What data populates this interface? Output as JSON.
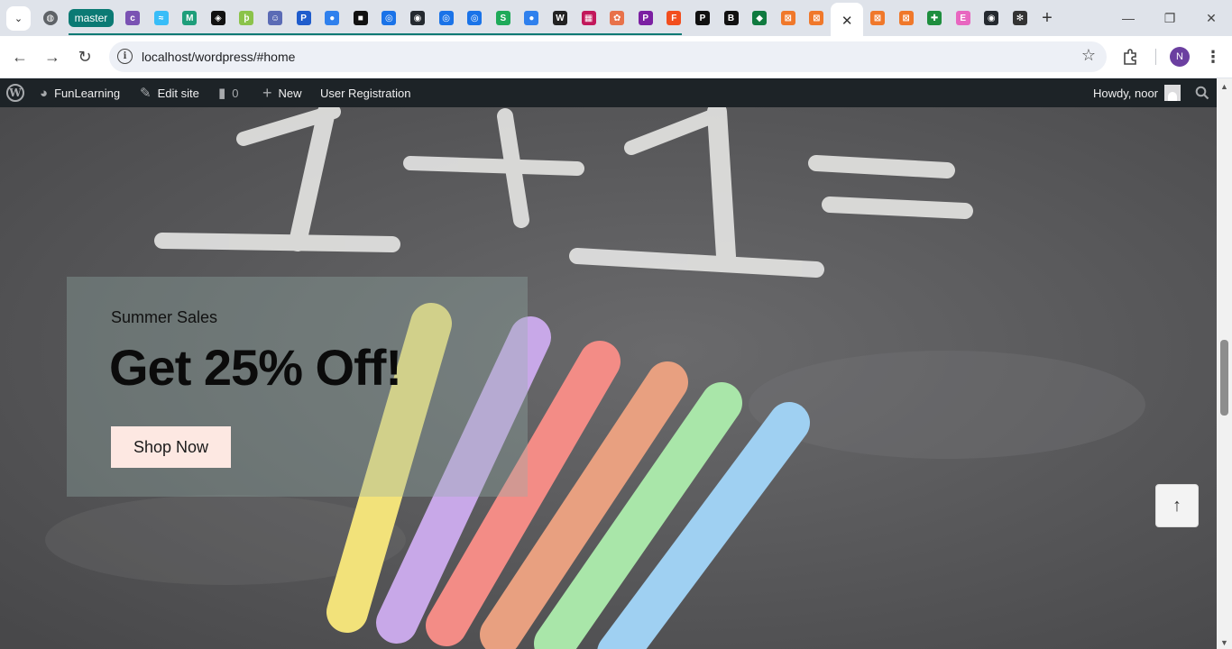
{
  "browser": {
    "tab_group_label": "master",
    "active_tab_close": "✕",
    "new_tab": "+",
    "window": {
      "minimize": "—",
      "restore": "❐",
      "close": "✕"
    },
    "tab_favicons": [
      {
        "name": "globe-favicon",
        "color": "#5f6368",
        "glyph": "◍"
      },
      {
        "name": "colorlib-favicon",
        "color": "#7a52b3",
        "glyph": "c"
      },
      {
        "name": "tailwind-favicon",
        "color": "#38bdf8",
        "glyph": "≈"
      },
      {
        "name": "dictionary-favicon",
        "color": "#1e9e7a",
        "glyph": "M"
      },
      {
        "name": "codepen-favicon",
        "color": "#111111",
        "glyph": "◈"
      },
      {
        "name": "feather-favicon",
        "color": "#8bc34a",
        "glyph": "ϸ"
      },
      {
        "name": "avatar-favicon",
        "color": "#5b6bb5",
        "glyph": "☺"
      },
      {
        "name": "pc-favicon",
        "color": "#1f5ccc",
        "glyph": "P"
      },
      {
        "name": "circle-favicon",
        "color": "#2f80ed",
        "glyph": "●"
      },
      {
        "name": "square-favicon",
        "color": "#111111",
        "glyph": "■"
      },
      {
        "name": "ring-favicon",
        "color": "#1a73e8",
        "glyph": "◎"
      },
      {
        "name": "github-favicon",
        "color": "#24292f",
        "glyph": "◉"
      },
      {
        "name": "ring-favicon-2",
        "color": "#1a73e8",
        "glyph": "◎"
      },
      {
        "name": "ring-favicon-3",
        "color": "#1a73e8",
        "glyph": "◎"
      },
      {
        "name": "s-favicon",
        "color": "#1faa59",
        "glyph": "S"
      },
      {
        "name": "circle-favicon-2",
        "color": "#2f80ed",
        "glyph": "●"
      },
      {
        "name": "wikipedia-favicon",
        "color": "#222222",
        "glyph": "W"
      },
      {
        "name": "pixel-favicon",
        "color": "#c2185b",
        "glyph": "▦"
      },
      {
        "name": "octopus-favicon",
        "color": "#e8724a",
        "glyph": "✿"
      },
      {
        "name": "ps-favicon",
        "color": "#7b1fa2",
        "glyph": "P"
      },
      {
        "name": "figma-favicon",
        "color": "#f24e1e",
        "glyph": "F"
      },
      {
        "name": "paypal-favicon",
        "color": "#111111",
        "glyph": "P"
      },
      {
        "name": "b-favicon",
        "color": "#111111",
        "glyph": "B"
      },
      {
        "name": "leaf-favicon",
        "color": "#0f7a3f",
        "glyph": "◆"
      },
      {
        "name": "xampp-favicon",
        "color": "#f0782a",
        "glyph": "⊠"
      },
      {
        "name": "xampp-favicon-2",
        "color": "#f0782a",
        "glyph": "⊠"
      }
    ],
    "tab_favicons_after": [
      {
        "name": "xampp-favicon-3",
        "color": "#f0782a",
        "glyph": "⊠"
      },
      {
        "name": "xampp-favicon-4",
        "color": "#f0782a",
        "glyph": "⊠"
      },
      {
        "name": "sheets-favicon",
        "color": "#1e8e3e",
        "glyph": "✚"
      },
      {
        "name": "elementor-favicon",
        "color": "#e866c0",
        "glyph": "E"
      },
      {
        "name": "github-favicon-2",
        "color": "#24292f",
        "glyph": "◉"
      },
      {
        "name": "openai-favicon",
        "color": "#333333",
        "glyph": "✻"
      }
    ],
    "address": "localhost/wordpress/#home",
    "profile_initial": "N"
  },
  "adminbar": {
    "site_name": "FunLearning",
    "edit_site": "Edit site",
    "comments_count": "0",
    "new_label": "New",
    "user_registration": "User Registration",
    "howdy": "Howdy, noor"
  },
  "hero": {
    "subtitle": "Summer Sales",
    "title": "Get 25% Off!",
    "button": "Shop Now",
    "to_top": "↑"
  }
}
